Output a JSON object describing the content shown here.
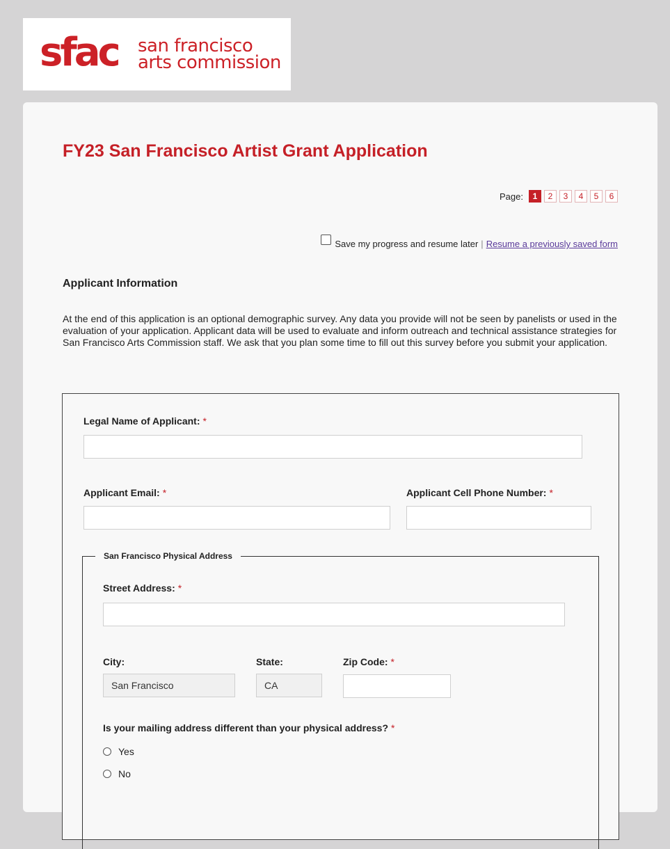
{
  "logo": {
    "mark": "sfac",
    "line1": "san francisco",
    "line2": "arts commission"
  },
  "form": {
    "title": "FY23 San Francisco Artist Grant Application"
  },
  "pager": {
    "label": "Page:",
    "pages": [
      "1",
      "2",
      "3",
      "4",
      "5",
      "6"
    ],
    "current": "1"
  },
  "save": {
    "label": "Save my progress and resume later",
    "separator": "|",
    "resume_link": "Resume a previously saved form"
  },
  "section": {
    "heading": "Applicant Information",
    "intro": "At the end of this application is an optional demographic survey. Any data you provide will not be seen by panelists or used in the evaluation of your application. Applicant data will be used to evaluate and inform outreach and technical assistance strategies for San Francisco Arts Commission staff. We ask that you plan some time to fill out this survey before you submit your application."
  },
  "fields": {
    "legal_name": {
      "label": "Legal Name of Applicant:",
      "required": "*",
      "value": ""
    },
    "email": {
      "label": "Applicant Email:",
      "required": "*",
      "value": ""
    },
    "phone": {
      "label": "Applicant Cell Phone Number:",
      "required": "*",
      "value": ""
    }
  },
  "address": {
    "legend": "San Francisco Physical Address",
    "street": {
      "label": "Street Address:",
      "required": "*",
      "value": ""
    },
    "city": {
      "label": "City:",
      "value": "San Francisco"
    },
    "state": {
      "label": "State:",
      "value": "CA"
    },
    "zip": {
      "label": "Zip Code:",
      "required": "*",
      "value": ""
    }
  },
  "mailing_question": {
    "label": "Is your mailing address different than your physical address?",
    "required": "*",
    "options": [
      "Yes",
      "No"
    ]
  },
  "colors": {
    "brand_red": "#c52027",
    "page_bg": "#d5d4d5",
    "card_bg": "#f8f8f8",
    "link_purple": "#5a3a9a"
  }
}
